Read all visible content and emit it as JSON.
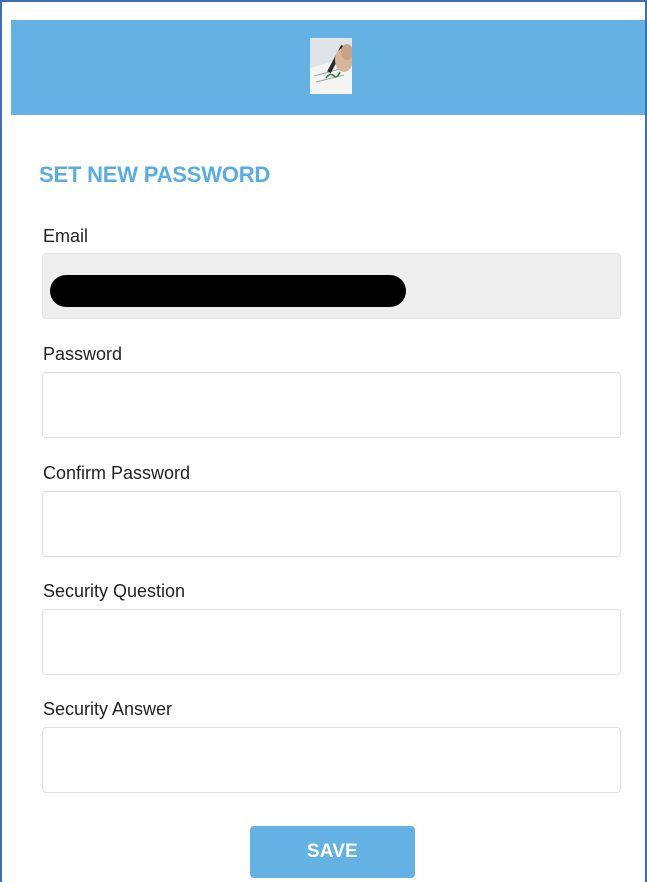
{
  "header": {
    "logo_icon": "pen-signing-icon",
    "background_color": "#64b1e3"
  },
  "form": {
    "title": "SET NEW PASSWORD",
    "title_color": "#5aade0",
    "fields": [
      {
        "label": "Email",
        "value": "",
        "readonly": true,
        "redacted": true
      },
      {
        "label": "Password",
        "value": ""
      },
      {
        "label": "Confirm Password",
        "value": ""
      },
      {
        "label": "Security Question",
        "value": ""
      },
      {
        "label": "Security Answer",
        "value": ""
      }
    ],
    "save_label": "SAVE"
  }
}
